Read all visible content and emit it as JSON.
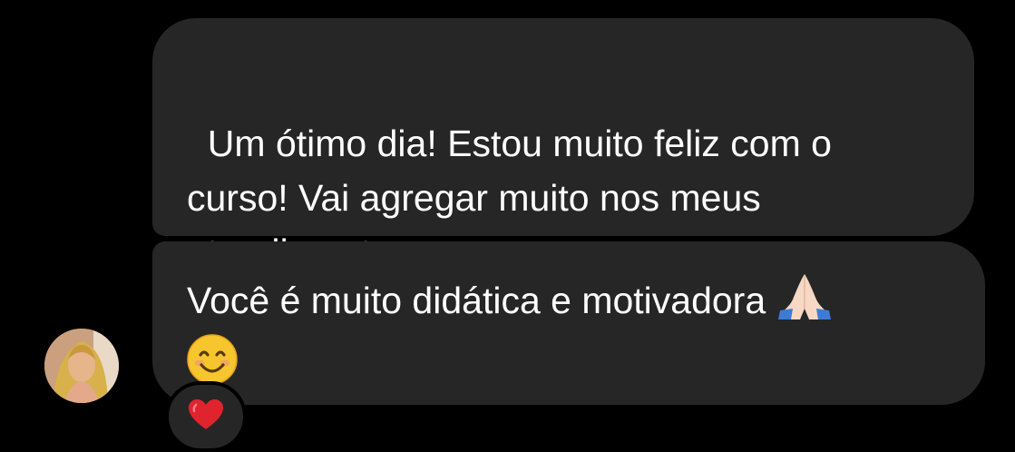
{
  "conversation": {
    "messages": [
      {
        "text": "Um ótimo dia! Estou muito feliz com o curso! Vai agregar muito nos meus atendimentos"
      },
      {
        "text": "Você é muito didática e motivadora ",
        "emojis": [
          "folded-hands-emoji",
          "smiling-face-emoji"
        ]
      }
    ],
    "reaction": {
      "icon": "red-heart-icon"
    },
    "avatar": {
      "icon": "profile-photo"
    }
  },
  "colors": {
    "background": "#000000",
    "bubble": "#262626",
    "text": "#ffffff",
    "heart": "#e0242e"
  }
}
